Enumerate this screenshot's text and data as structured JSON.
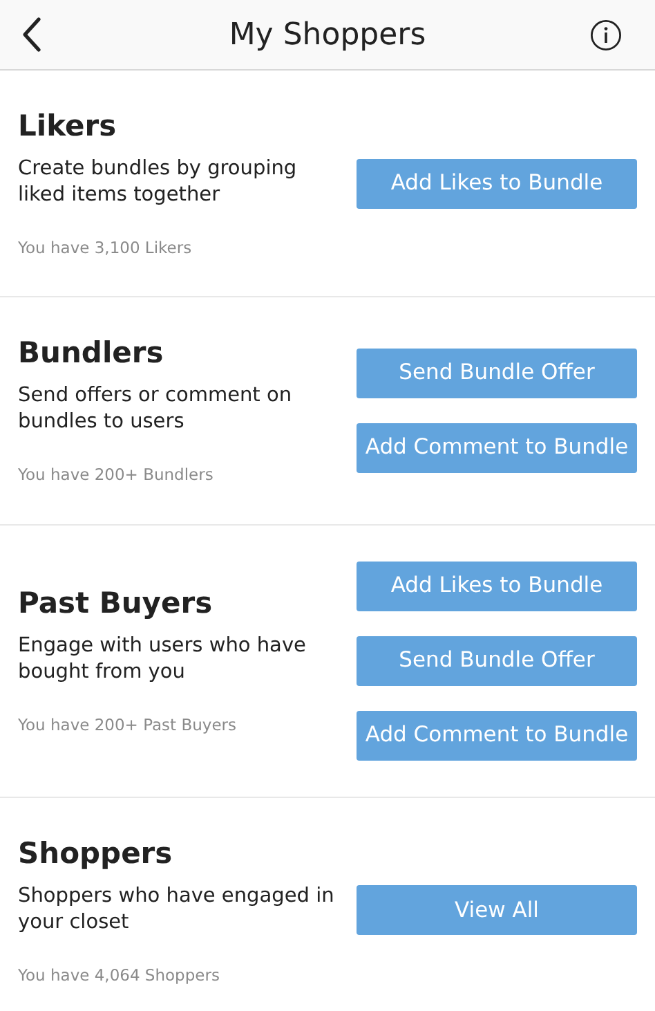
{
  "header": {
    "title": "My Shoppers"
  },
  "sections": [
    {
      "title": "Likers",
      "description": "Create bundles by grouping liked items together",
      "count": "You have 3,100 Likers",
      "buttons": [
        "Add Likes to Bundle"
      ]
    },
    {
      "title": "Bundlers",
      "description": "Send offers or comment on bundles to users",
      "count": "You have 200+ Bundlers",
      "buttons": [
        "Send Bundle Offer",
        "Add Comment to Bundle"
      ]
    },
    {
      "title": "Past Buyers",
      "description": "Engage with users who have bought from you",
      "count": "You have 200+ Past Buyers",
      "buttons": [
        "Add Likes to Bundle",
        "Send Bundle Offer",
        "Add Comment to Bundle"
      ]
    },
    {
      "title": "Shoppers",
      "description": "Shoppers who have engaged in your closet",
      "count": "You have 4,064 Shoppers",
      "buttons": [
        "View All"
      ]
    }
  ]
}
